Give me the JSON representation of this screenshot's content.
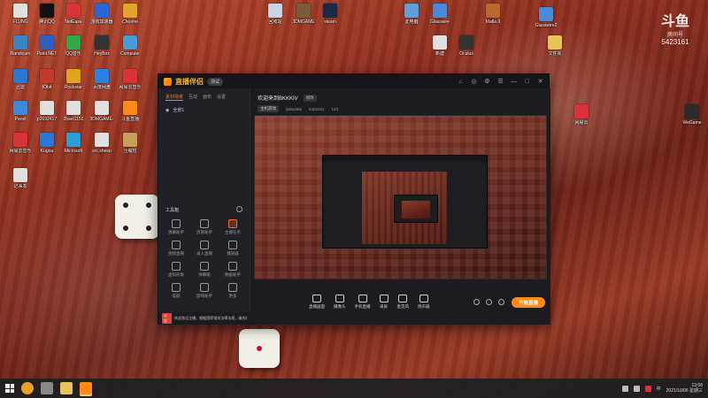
{
  "watermark": {
    "logo": "斗鱼",
    "sub": "房间号",
    "room_number": "5423161"
  },
  "desktop": {
    "icons": [
      {
        "label": "回收站",
        "color": "#c9d4e3"
      },
      {
        "label": "3DMGAME",
        "color": "#7b5c3a"
      },
      {
        "label": "steam",
        "color": "#1b2a46"
      },
      {
        "label": "此电脑",
        "color": "#5f9fd6"
      },
      {
        "label": "Glasswire",
        "color": "#4a8ad8"
      },
      {
        "label": "Mafia II",
        "color": "#b86a2a"
      },
      {
        "label": "Glasswire2",
        "color": "#4a8ad8"
      },
      {
        "label": "文件夹",
        "color": "#e8c35a"
      },
      {
        "label": "新建",
        "color": "#e0e0e0"
      },
      {
        "label": "Oculus",
        "color": "#333333"
      },
      {
        "label": "网易云",
        "color": "#d9323a"
      },
      {
        "label": "WeGame",
        "color": "#2b2b2b"
      },
      {
        "label": "FLUNG",
        "color": "#e0e0e0"
      },
      {
        "label": "腾讯QQ",
        "color": "#111111"
      },
      {
        "label": "NetEase",
        "color": "#d9323a"
      },
      {
        "label": "游戏加速器",
        "color": "#2a66d6"
      },
      {
        "label": "Chrome",
        "color": "#e3a42a"
      },
      {
        "label": "Bandicam",
        "color": "#3a84c4"
      },
      {
        "label": "Paint.NET",
        "color": "#2b5fc4"
      },
      {
        "label": "QQ音乐",
        "color": "#2fa94a"
      },
      {
        "label": "HeyBox",
        "color": "#333333"
      },
      {
        "label": "Computer",
        "color": "#4a9ad8"
      },
      {
        "label": "迅雷",
        "color": "#2a78d6"
      },
      {
        "label": "IObit",
        "color": "#c23a2a"
      },
      {
        "label": "Rockstar",
        "color": "#e0a51a"
      },
      {
        "label": "百度网盘",
        "color": "#2a82e4"
      },
      {
        "label": "网易云音乐",
        "color": "#d9323a"
      },
      {
        "label": "Panel",
        "color": "#3a8ad8"
      },
      {
        "label": "p2692417",
        "color": "#e0e0e0"
      },
      {
        "label": "2bset1150",
        "color": "#e0e0e0"
      },
      {
        "label": "3DMGAME-",
        "color": "#e0e0e0"
      },
      {
        "label": "斗鱼直播",
        "color": "#ff8a1a"
      },
      {
        "label": "网易云音乐",
        "color": "#d9323a"
      },
      {
        "label": "Kugou",
        "color": "#2a78d6"
      },
      {
        "label": "Microsoft",
        "color": "#2aa0d6"
      },
      {
        "label": "src.sheep",
        "color": "#e0e0e0"
      },
      {
        "label": "压缩包",
        "color": "#c9a05a"
      },
      {
        "label": "记事本",
        "color": "#e0e0e0"
      }
    ]
  },
  "app": {
    "title": "直播伴侣",
    "badge": "测试",
    "titlebar_controls": [
      "⌂",
      "◎",
      "⚙",
      "☰",
      "—",
      "□",
      "✕"
    ]
  },
  "sidebar": {
    "tabs": [
      "素材场景",
      "互动",
      "画布",
      "设置"
    ],
    "scene_label": "全景1",
    "tools_label": "工具箱",
    "tools": [
      {
        "label": "弹幕助手",
        "hot": false
      },
      {
        "label": "房管助手",
        "hot": false
      },
      {
        "label": "主播任务",
        "hot": true
      },
      {
        "label": "视频直播",
        "hot": false
      },
      {
        "label": "录入直播",
        "hot": false
      },
      {
        "label": "播放器",
        "hot": false
      },
      {
        "label": "虚拟形象",
        "hot": false
      },
      {
        "label": "弹幕聊",
        "hot": false
      },
      {
        "label": "数据助手",
        "hot": false
      },
      {
        "label": "美颜",
        "hot": false
      },
      {
        "label": "游戏助手",
        "hot": false
      },
      {
        "label": "更多",
        "hot": false
      }
    ],
    "notice_tag": "公告",
    "notice_text": "欢迎各位主播，根据国家相关法律法规，请合规直播"
  },
  "main": {
    "room_title": "欢迎来到BKKKIV",
    "edit_label": "修改",
    "meta": {
      "category_tag": "主机游戏",
      "user": "jiahui366",
      "room_id": "5423161",
      "fans": "123"
    },
    "controls": [
      "直播画面",
      "摄像头",
      "手机直播",
      "录屏",
      "麦克风",
      "扬声器"
    ],
    "go_live_label": "开始直播"
  },
  "taskbar": {
    "tray_text": "中",
    "time": "13:58",
    "date": "2021/10/06 星期三"
  }
}
